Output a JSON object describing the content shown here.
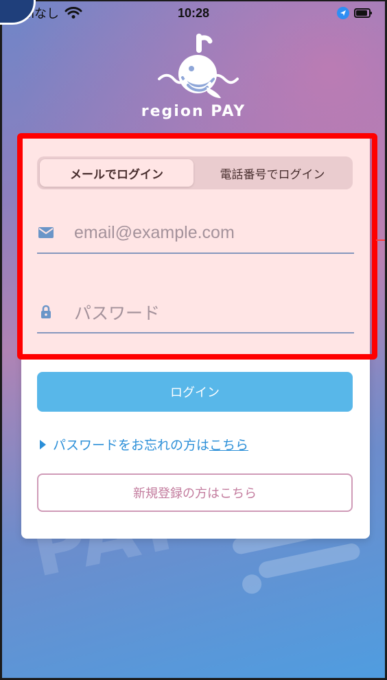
{
  "status_bar": {
    "carrier": "SIMなし",
    "time": "10:28"
  },
  "brand": {
    "name": "region PAY"
  },
  "watermark": {
    "text": "PAY"
  },
  "login_tabs": {
    "email_tab_label": "メールでログイン",
    "phone_tab_label": "電話番号でログイン",
    "active_tab": "email"
  },
  "form": {
    "email_placeholder": "email@example.com",
    "password_placeholder": "パスワード"
  },
  "actions": {
    "login_label": "ログイン",
    "forgot_text": "パスワードをお忘れの方は",
    "forgot_link_text": "こちら",
    "signup_label": "新規登録の方はこちら"
  },
  "icons": {
    "status": [
      "wifi-icon",
      "location-icon",
      "battery-icon"
    ],
    "email": "mail-icon",
    "password": "lock-icon",
    "forgot": "triangle-right-icon"
  },
  "colors": {
    "primary_button": "#58b7e9",
    "link": "#2b8fd8",
    "highlight": "#ff0000",
    "signup_border": "#cf9ab7",
    "signup_text": "#c37c9e"
  }
}
